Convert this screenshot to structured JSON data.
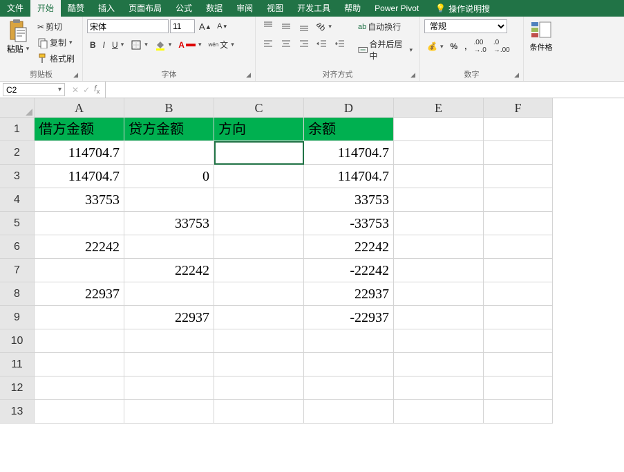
{
  "tabs": [
    "文件",
    "开始",
    "酷赞",
    "插入",
    "页面布局",
    "公式",
    "数据",
    "审阅",
    "视图",
    "开发工具",
    "帮助",
    "Power Pivot"
  ],
  "active_tab": 1,
  "tell_me": "操作说明搜",
  "clipboard": {
    "paste": "粘贴",
    "cut": "剪切",
    "copy": "复制",
    "format_painter": "格式刷",
    "group": "剪贴板"
  },
  "font": {
    "family": "宋体",
    "size": "11",
    "group": "字体",
    "ruby": "wén"
  },
  "alignment": {
    "wrap": "自动换行",
    "merge": "合并后居中",
    "group": "对齐方式"
  },
  "number": {
    "format": "常规",
    "group": "数字"
  },
  "styles": {
    "cond": "条件格"
  },
  "name_box": "C2",
  "columns": [
    "A",
    "B",
    "C",
    "D",
    "E",
    "F"
  ],
  "row_count": 13,
  "headers": [
    "借方金额",
    "贷方金额",
    "方向",
    "余额"
  ],
  "rows": [
    [
      "114704.7",
      "",
      "",
      "114704.7"
    ],
    [
      "114704.7",
      "0",
      "",
      "114704.7"
    ],
    [
      "33753",
      "",
      "",
      "33753"
    ],
    [
      "",
      "33753",
      "",
      "-33753"
    ],
    [
      "22242",
      "",
      "",
      "22242"
    ],
    [
      "",
      "22242",
      "",
      "-22242"
    ],
    [
      "22937",
      "",
      "",
      "22937"
    ],
    [
      "",
      "22937",
      "",
      "-22937"
    ]
  ],
  "selected_cell": "C2"
}
